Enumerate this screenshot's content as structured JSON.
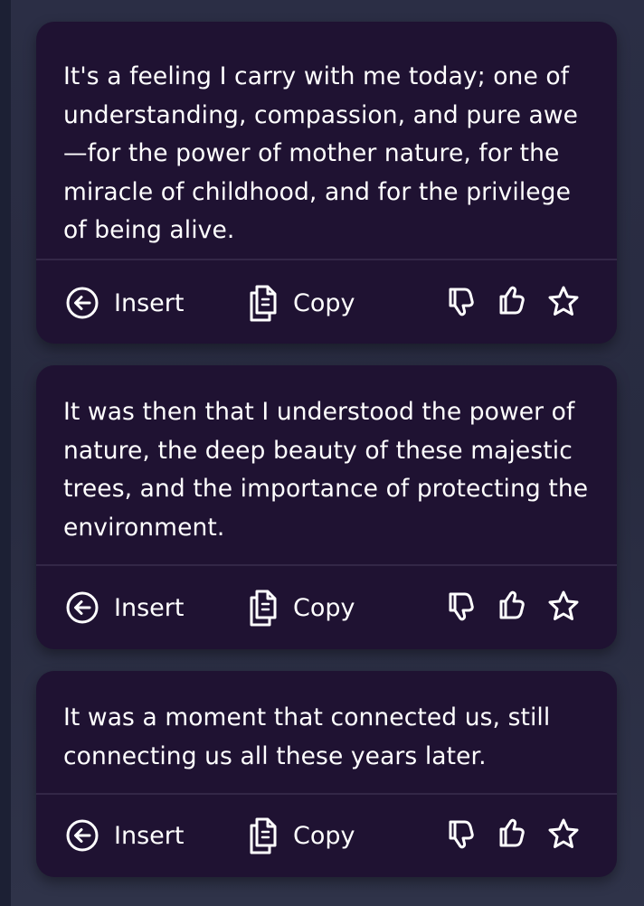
{
  "cards": [
    {
      "text": "It's a feeling I carry with me today; one of understanding, compassion, and pure awe—for the power of mother nature, for the miracle of childhood, and for the privilege of being alive.",
      "insert_label": "Insert",
      "copy_label": "Copy"
    },
    {
      "text": "It was then that I understood the power of nature, the deep beauty of these majestic trees, and the importance of protecting the environment.",
      "insert_label": "Insert",
      "copy_label": "Copy"
    },
    {
      "text": "It was a moment that connected us, still connecting us all these years later.",
      "insert_label": "Insert",
      "copy_label": "Copy"
    }
  ],
  "icons": {
    "insert": "arrow-left-circle-icon",
    "copy": "copy-documents-icon",
    "dislike": "thumbs-down-icon",
    "like": "thumbs-up-icon",
    "favorite": "star-icon"
  },
  "colors": {
    "card_background": "#1f1232",
    "page_background": "#2b2e45",
    "text": "#ffffff",
    "divider": "#332747"
  }
}
